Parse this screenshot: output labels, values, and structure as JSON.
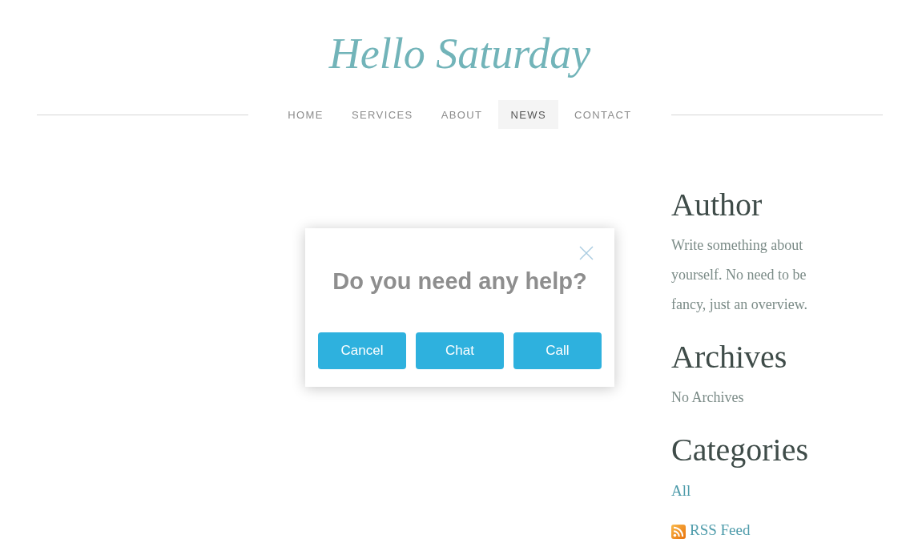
{
  "site": {
    "logo": "Hello Saturday"
  },
  "nav": [
    {
      "label": "HOME",
      "selected": false
    },
    {
      "label": "SERVICES",
      "selected": false
    },
    {
      "label": "ABOUT",
      "selected": false
    },
    {
      "label": "NEWS",
      "selected": true
    },
    {
      "label": "CONTACT",
      "selected": false
    }
  ],
  "sidebar": {
    "sections": [
      {
        "kind": "text",
        "heading": "Author",
        "body": "Write something about yourself. No need to be fancy, just an overview."
      },
      {
        "kind": "text",
        "heading": "Archives",
        "body": "No Archives"
      },
      {
        "kind": "links",
        "heading": "Categories",
        "links": [
          "All"
        ]
      }
    ],
    "rss_link": "RSS Feed"
  },
  "dialog": {
    "title": "Do you need any help?",
    "buttons": [
      "Cancel",
      "Chat",
      "Call"
    ]
  }
}
